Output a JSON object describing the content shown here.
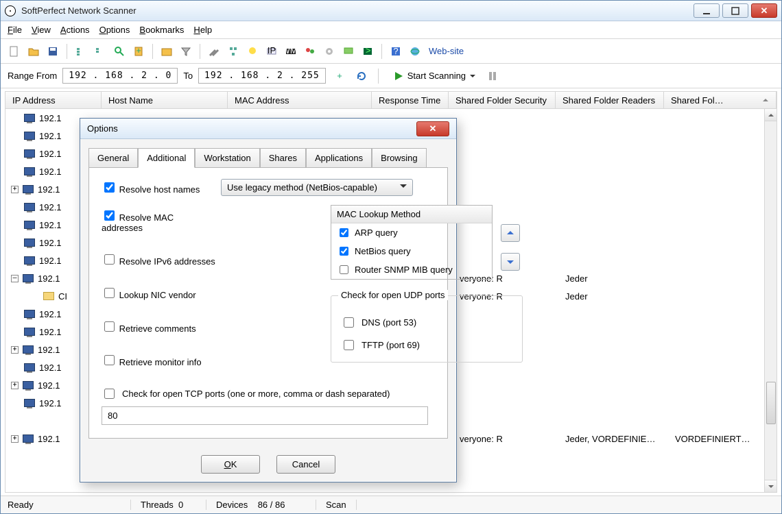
{
  "app_title": "SoftPerfect Network Scanner",
  "menus": [
    "File",
    "View",
    "Actions",
    "Options",
    "Bookmarks",
    "Help"
  ],
  "menus_accel": [
    "F",
    "V",
    "A",
    "O",
    "B",
    "H"
  ],
  "toolbar": {
    "website_label": "Web-site"
  },
  "range": {
    "from_label": "Range From",
    "to_label": "To",
    "ip_from": "192  .  168  .    2   .    0",
    "ip_to": "192  .  168  .    2   .  255",
    "start_label": "Start Scanning"
  },
  "columns": {
    "ip": "IP Address",
    "host": "Host Name",
    "mac": "MAC Address",
    "resp": "Response Time",
    "sec": "Shared Folder Security",
    "read": "Shared Folder Readers",
    "fold": "Shared Fol…"
  },
  "rows": [
    {
      "exp": "",
      "ip": "192.1",
      "kind": "pc"
    },
    {
      "exp": "",
      "ip": "192.1",
      "kind": "pc"
    },
    {
      "exp": "",
      "ip": "192.1",
      "kind": "pc"
    },
    {
      "exp": "",
      "ip": "192.1",
      "kind": "pc"
    },
    {
      "exp": "+",
      "ip": "192.1",
      "kind": "pc"
    },
    {
      "exp": "",
      "ip": "192.1",
      "kind": "pc"
    },
    {
      "exp": "",
      "ip": "192.1",
      "kind": "pc"
    },
    {
      "exp": "",
      "ip": "192.1",
      "kind": "pc"
    },
    {
      "exp": "",
      "ip": "192.1",
      "kind": "pc"
    },
    {
      "exp": "–",
      "ip": "192.1",
      "kind": "pc",
      "sec": "veryone: R",
      "read": "Jeder"
    },
    {
      "exp": "",
      "ip": "CI",
      "kind": "folder",
      "indent": true,
      "sec": "veryone: R",
      "read": "Jeder"
    },
    {
      "exp": "",
      "ip": "192.1",
      "kind": "pc"
    },
    {
      "exp": "",
      "ip": "192.1",
      "kind": "pc"
    },
    {
      "exp": "+",
      "ip": "192.1",
      "kind": "pc"
    },
    {
      "exp": "",
      "ip": "192.1",
      "kind": "pc"
    },
    {
      "exp": "+",
      "ip": "192.1",
      "kind": "pc"
    },
    {
      "exp": "",
      "ip": "192.1",
      "kind": "pc"
    },
    {
      "exp": "",
      "ip": "",
      "kind": "none"
    },
    {
      "exp": "+",
      "ip": "192.1",
      "kind": "pc",
      "sec": "veryone: R",
      "read": "Jeder, VORDEFINIE…",
      "fold": "VORDEFINIERT…"
    }
  ],
  "status": {
    "ready": "Ready",
    "threads_label": "Threads",
    "threads_val": "0",
    "devices_label": "Devices",
    "devices_val": "86 / 86",
    "scan_label": "Scan"
  },
  "dialog": {
    "title": "Options",
    "tabs": [
      "General",
      "Additional",
      "Workstation",
      "Shares",
      "Applications",
      "Browsing"
    ],
    "active_tab": 1,
    "resolve_host": "Resolve host names",
    "resolve_host_chk": true,
    "resolve_method": "Use legacy method (NetBios-capable)",
    "resolve_mac": "Resolve MAC addresses",
    "resolve_mac_chk": true,
    "resolve_ipv6": "Resolve IPv6 addresses",
    "resolve_ipv6_chk": false,
    "lookup_nic": "Lookup NIC vendor",
    "lookup_nic_chk": false,
    "retrieve_comments": "Retrieve comments",
    "retrieve_comments_chk": false,
    "retrieve_monitor": "Retrieve monitor info",
    "retrieve_monitor_chk": false,
    "mac_lookup_header": "MAC Lookup Method",
    "mac_methods": [
      {
        "label": "ARP query",
        "checked": true
      },
      {
        "label": "NetBios query",
        "checked": true
      },
      {
        "label": "Router SNMP MIB query",
        "checked": false
      }
    ],
    "udp_legend": "Check for open UDP ports",
    "udp_dns": "DNS (port 53)",
    "udp_dns_chk": false,
    "udp_tftp": "TFTP (port 69)",
    "udp_tftp_chk": false,
    "tcp_label": "Check for open TCP ports (one or more, comma or dash separated)",
    "tcp_chk": false,
    "tcp_value": "80",
    "ok": "OK",
    "cancel": "Cancel"
  }
}
